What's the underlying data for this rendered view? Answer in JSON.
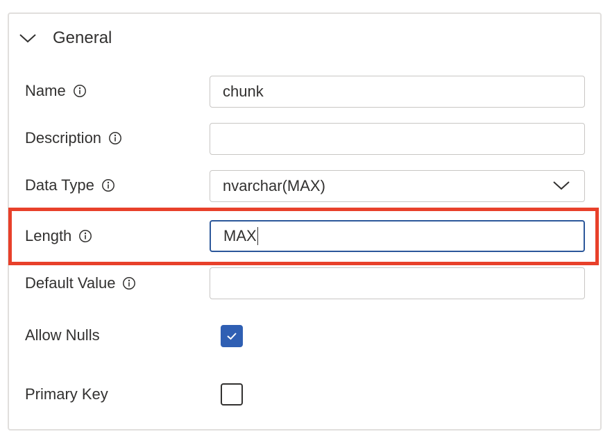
{
  "section": {
    "title": "General",
    "expanded": true,
    "chevron_icon": "chevron-down-icon"
  },
  "fields": {
    "name": {
      "label": "Name",
      "value": "chunk"
    },
    "description": {
      "label": "Description",
      "value": ""
    },
    "data_type": {
      "label": "Data Type",
      "value": "nvarchar(MAX)"
    },
    "length": {
      "label": "Length",
      "value": "MAX"
    },
    "default_value": {
      "label": "Default Value",
      "value": ""
    },
    "allow_nulls": {
      "label": "Allow Nulls",
      "checked": true
    },
    "primary_key": {
      "label": "Primary Key",
      "checked": false
    }
  },
  "colors": {
    "highlight": "#e8402a",
    "focus_border": "#2b579a",
    "checkbox_checked": "#2f5fb3"
  }
}
